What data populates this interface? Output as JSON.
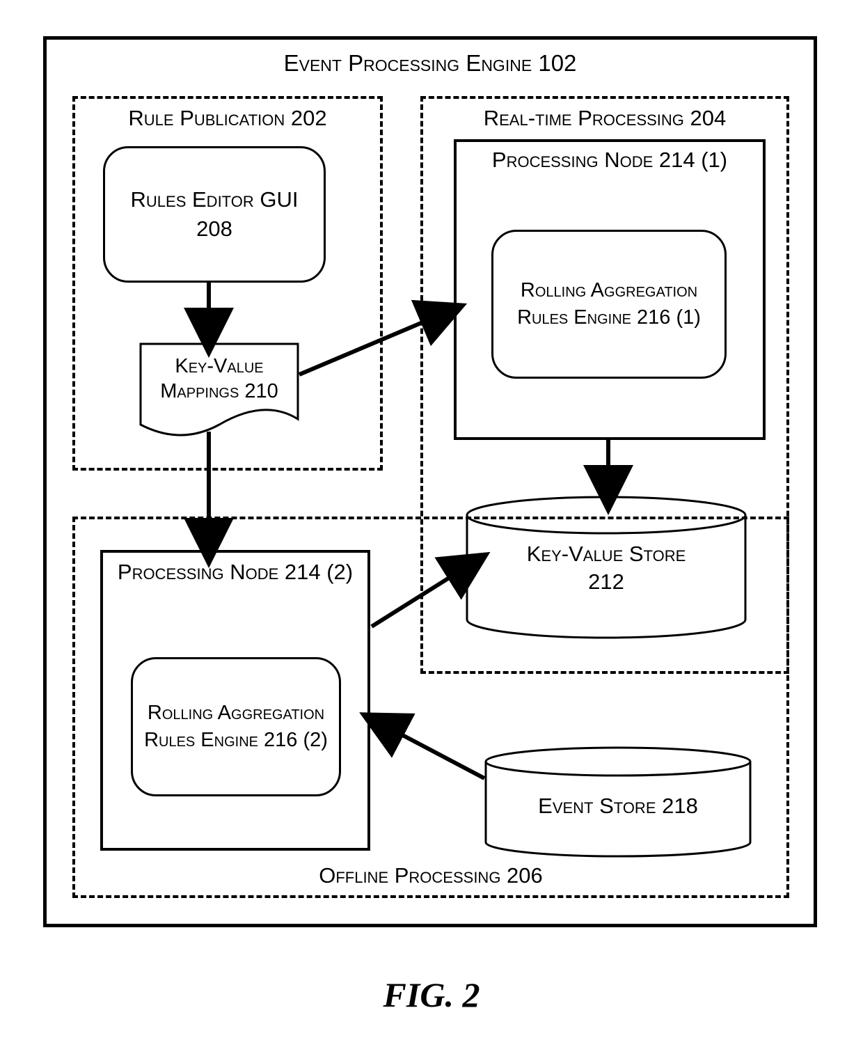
{
  "title": "Event Processing Engine 102",
  "rule_publication": {
    "title": "Rule Publication 202",
    "rules_editor": {
      "line1": "Rules Editor GUI",
      "line2": "208"
    },
    "key_value_mappings": "Key-Value Mappings 210"
  },
  "realtime": {
    "title": "Real-time Processing 204",
    "processing_node": {
      "title": "Processing Node 214 (1)",
      "rolling": "Rolling Aggregation Rules Engine 216 (1)"
    },
    "kv_store": {
      "line1": "Key-Value Store",
      "line2": "212"
    }
  },
  "offline": {
    "title": "Offline Processing 206",
    "processing_node": {
      "title": "Processing Node 214 (2)",
      "rolling": "Rolling Aggregation Rules Engine 216 (2)"
    },
    "event_store": "Event Store 218"
  },
  "figure_caption": "FIG. 2"
}
